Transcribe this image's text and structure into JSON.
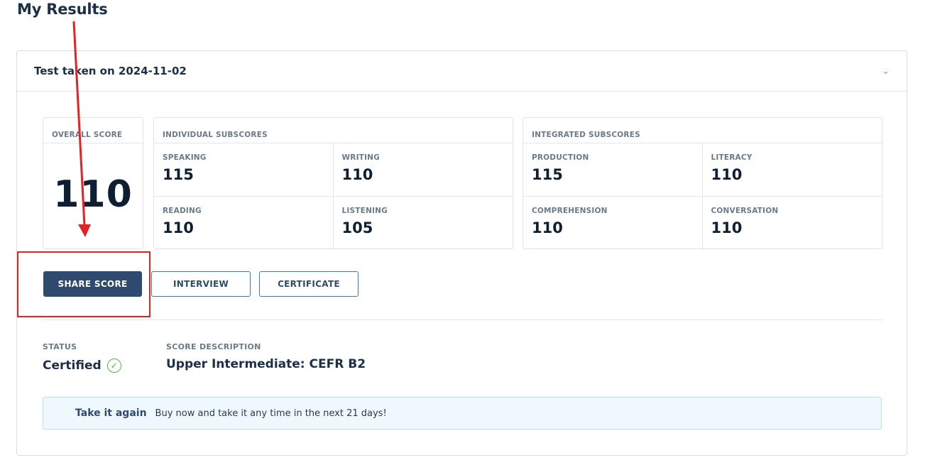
{
  "page": {
    "title": "My Results"
  },
  "card": {
    "title": "Test taken on 2024-11-02",
    "chevron_icon": "chevron-down-icon"
  },
  "overall": {
    "label": "OVERALL SCORE",
    "value": "110"
  },
  "individual": {
    "label": "INDIVIDUAL SUBSCORES",
    "items": [
      {
        "label": "SPEAKING",
        "value": "115"
      },
      {
        "label": "WRITING",
        "value": "110"
      },
      {
        "label": "READING",
        "value": "110"
      },
      {
        "label": "LISTENING",
        "value": "105"
      }
    ]
  },
  "integrated": {
    "label": "INTEGRATED SUBSCORES",
    "items": [
      {
        "label": "PRODUCTION",
        "value": "115"
      },
      {
        "label": "LITERACY",
        "value": "110"
      },
      {
        "label": "COMPREHENSION",
        "value": "110"
      },
      {
        "label": "CONVERSATION",
        "value": "110"
      }
    ]
  },
  "actions": {
    "share": "SHARE SCORE",
    "interview": "INTERVIEW",
    "certificate": "CERTIFICATE"
  },
  "status": {
    "label": "STATUS",
    "value": "Certified",
    "icon": "check-circle-icon"
  },
  "description": {
    "label": "SCORE DESCRIPTION",
    "value": "Upper Intermediate: CEFR B2"
  },
  "banner": {
    "title": "Take it again",
    "text": "Buy now and take it any time in the next 21 days!"
  },
  "colors": {
    "primary": "#2e4a6e",
    "annotation": "#e52222",
    "success": "#4cbb3f",
    "banner_bg": "#eef8fd"
  }
}
